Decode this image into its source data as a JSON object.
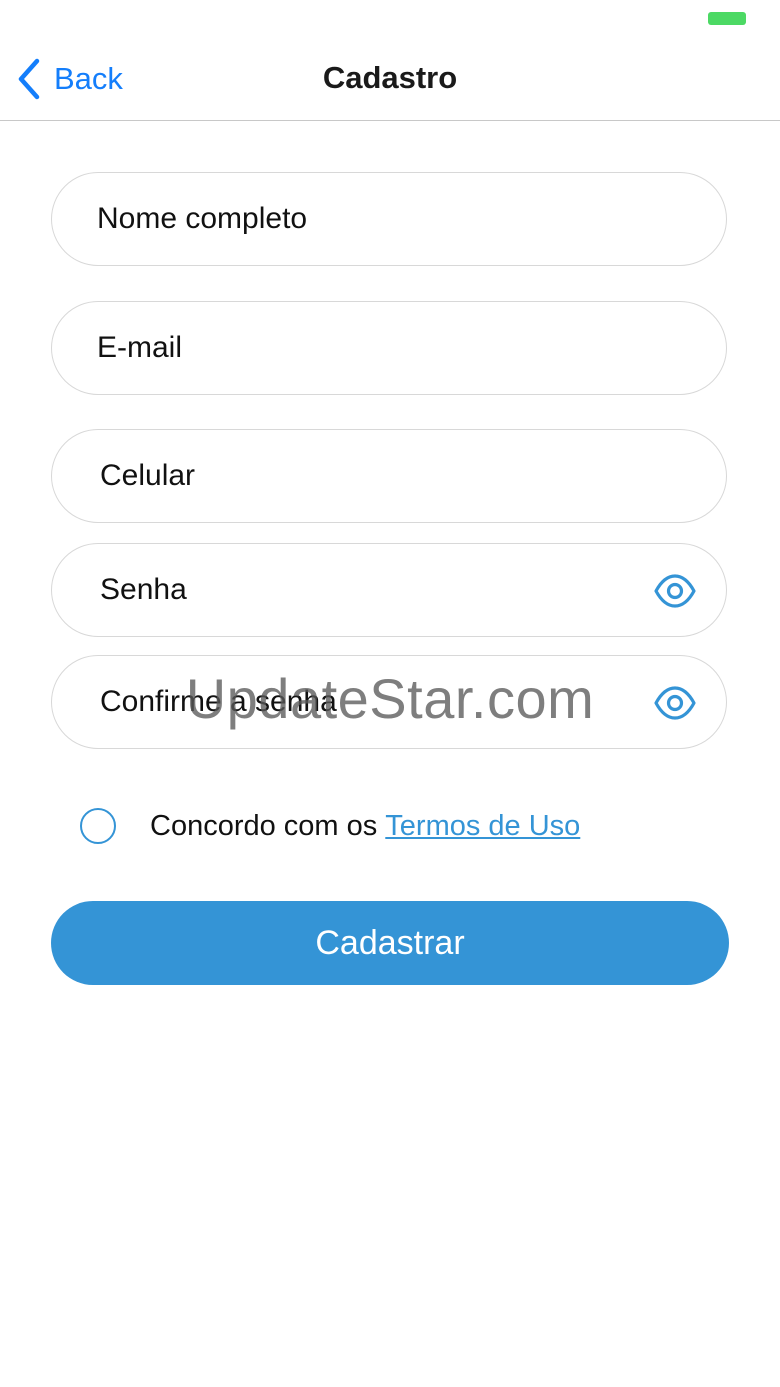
{
  "status_bar": {
    "battery_color": "#4cd964"
  },
  "nav": {
    "back_label": "Back",
    "title": "Cadastro",
    "accent_color": "#147efb"
  },
  "form": {
    "fields": [
      {
        "placeholder": "Nome completo",
        "icon": null
      },
      {
        "placeholder": "E-mail",
        "icon": null
      },
      {
        "placeholder": "Celular",
        "icon": null
      },
      {
        "placeholder": "Senha",
        "icon": "eye-icon"
      },
      {
        "placeholder": "Confirme a senha",
        "icon": "eye-icon"
      }
    ],
    "terms": {
      "text": "Concordo com os",
      "link": "Termos de Uso",
      "checked": false
    },
    "submit_label": "Cadastrar",
    "primary_color": "#3494d6"
  },
  "watermark": "UpdateStar.com"
}
